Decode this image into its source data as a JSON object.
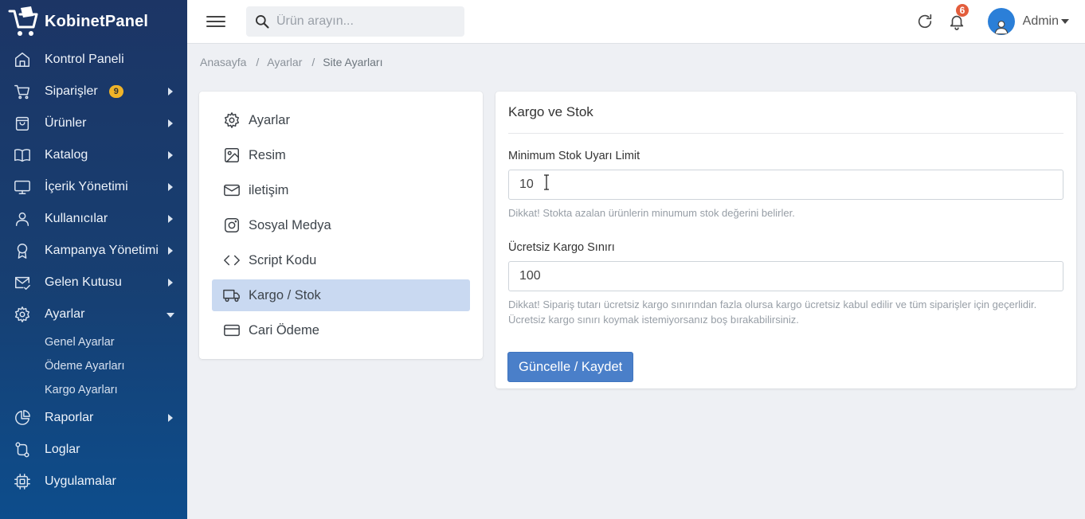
{
  "brand": {
    "name": "KobinetPanel"
  },
  "sidebar": {
    "items": [
      {
        "icon": "home-icon",
        "label": "Kontrol Paneli",
        "arrow": false
      },
      {
        "icon": "cart-icon",
        "label": "Siparişler",
        "badge": "9",
        "arrow": true
      },
      {
        "icon": "bag-icon",
        "label": "Ürünler",
        "arrow": true
      },
      {
        "icon": "book-icon",
        "label": "Katalog",
        "arrow": true
      },
      {
        "icon": "monitor-icon",
        "label": "İçerik Yönetimi",
        "arrow": true
      },
      {
        "icon": "user-icon",
        "label": "Kullanıcılar",
        "arrow": true
      },
      {
        "icon": "award-icon",
        "label": "Kampanya Yönetimi",
        "arrow": true
      },
      {
        "icon": "mail-check-icon",
        "label": "Gelen Kutusu",
        "arrow": true
      },
      {
        "icon": "gear-icon",
        "label": "Ayarlar",
        "expanded": true
      }
    ],
    "subitems": [
      "Genel Ayarlar",
      "Ödeme Ayarları",
      "Kargo Ayarları"
    ],
    "items_after": [
      {
        "icon": "pie-chart-icon",
        "label": "Raporlar",
        "arrow": true
      },
      {
        "icon": "git-compare-icon",
        "label": "Loglar",
        "arrow": false
      },
      {
        "icon": "cpu-icon",
        "label": "Uygulamalar",
        "arrow": false
      }
    ]
  },
  "topbar": {
    "search_placeholder": "Ürün arayın...",
    "notifications_count": "6",
    "user_name": "Admin"
  },
  "breadcrumb": [
    "Anasayfa",
    "Ayarlar",
    "Site Ayarları"
  ],
  "settings_menu": [
    {
      "icon": "gear-icon",
      "label": "Ayarlar"
    },
    {
      "icon": "image-icon",
      "label": "Resim"
    },
    {
      "icon": "mail-icon",
      "label": "iletişim"
    },
    {
      "icon": "instagram-icon",
      "label": "Sosyal Medya"
    },
    {
      "icon": "code-icon",
      "label": "Script Kodu"
    },
    {
      "icon": "truck-icon",
      "label": "Kargo / Stok",
      "active": true
    },
    {
      "icon": "credit-card-icon",
      "label": "Cari Ödeme"
    }
  ],
  "form": {
    "title": "Kargo ve Stok",
    "min_stock_label": "Minimum Stok Uyarı Limit",
    "min_stock_value": "10",
    "min_stock_help": "Dikkat! Stokta azalan ürünlerin minumum stok değerini belirler.",
    "free_shipping_label": "Ücretsiz Kargo Sınırı",
    "free_shipping_value": "100",
    "free_shipping_help": "Dikkat! Sipariş tutarı ücretsiz kargo sınırından fazla olursa kargo ücretsiz kabul edilir ve tüm siparişler için geçerlidir. Ücretsiz kargo sınırı koymak istemiyorsanız boş bırakabilirsiniz.",
    "save_label": "Güncelle / Kaydet"
  },
  "colors": {
    "sidebar_top": "#1c3565",
    "sidebar_bottom": "#0d4d8c",
    "accent": "#4a7fc9",
    "active_menu": "#c9d9f1",
    "badge": "#f0b429",
    "notif_badge": "#e35d3c"
  }
}
